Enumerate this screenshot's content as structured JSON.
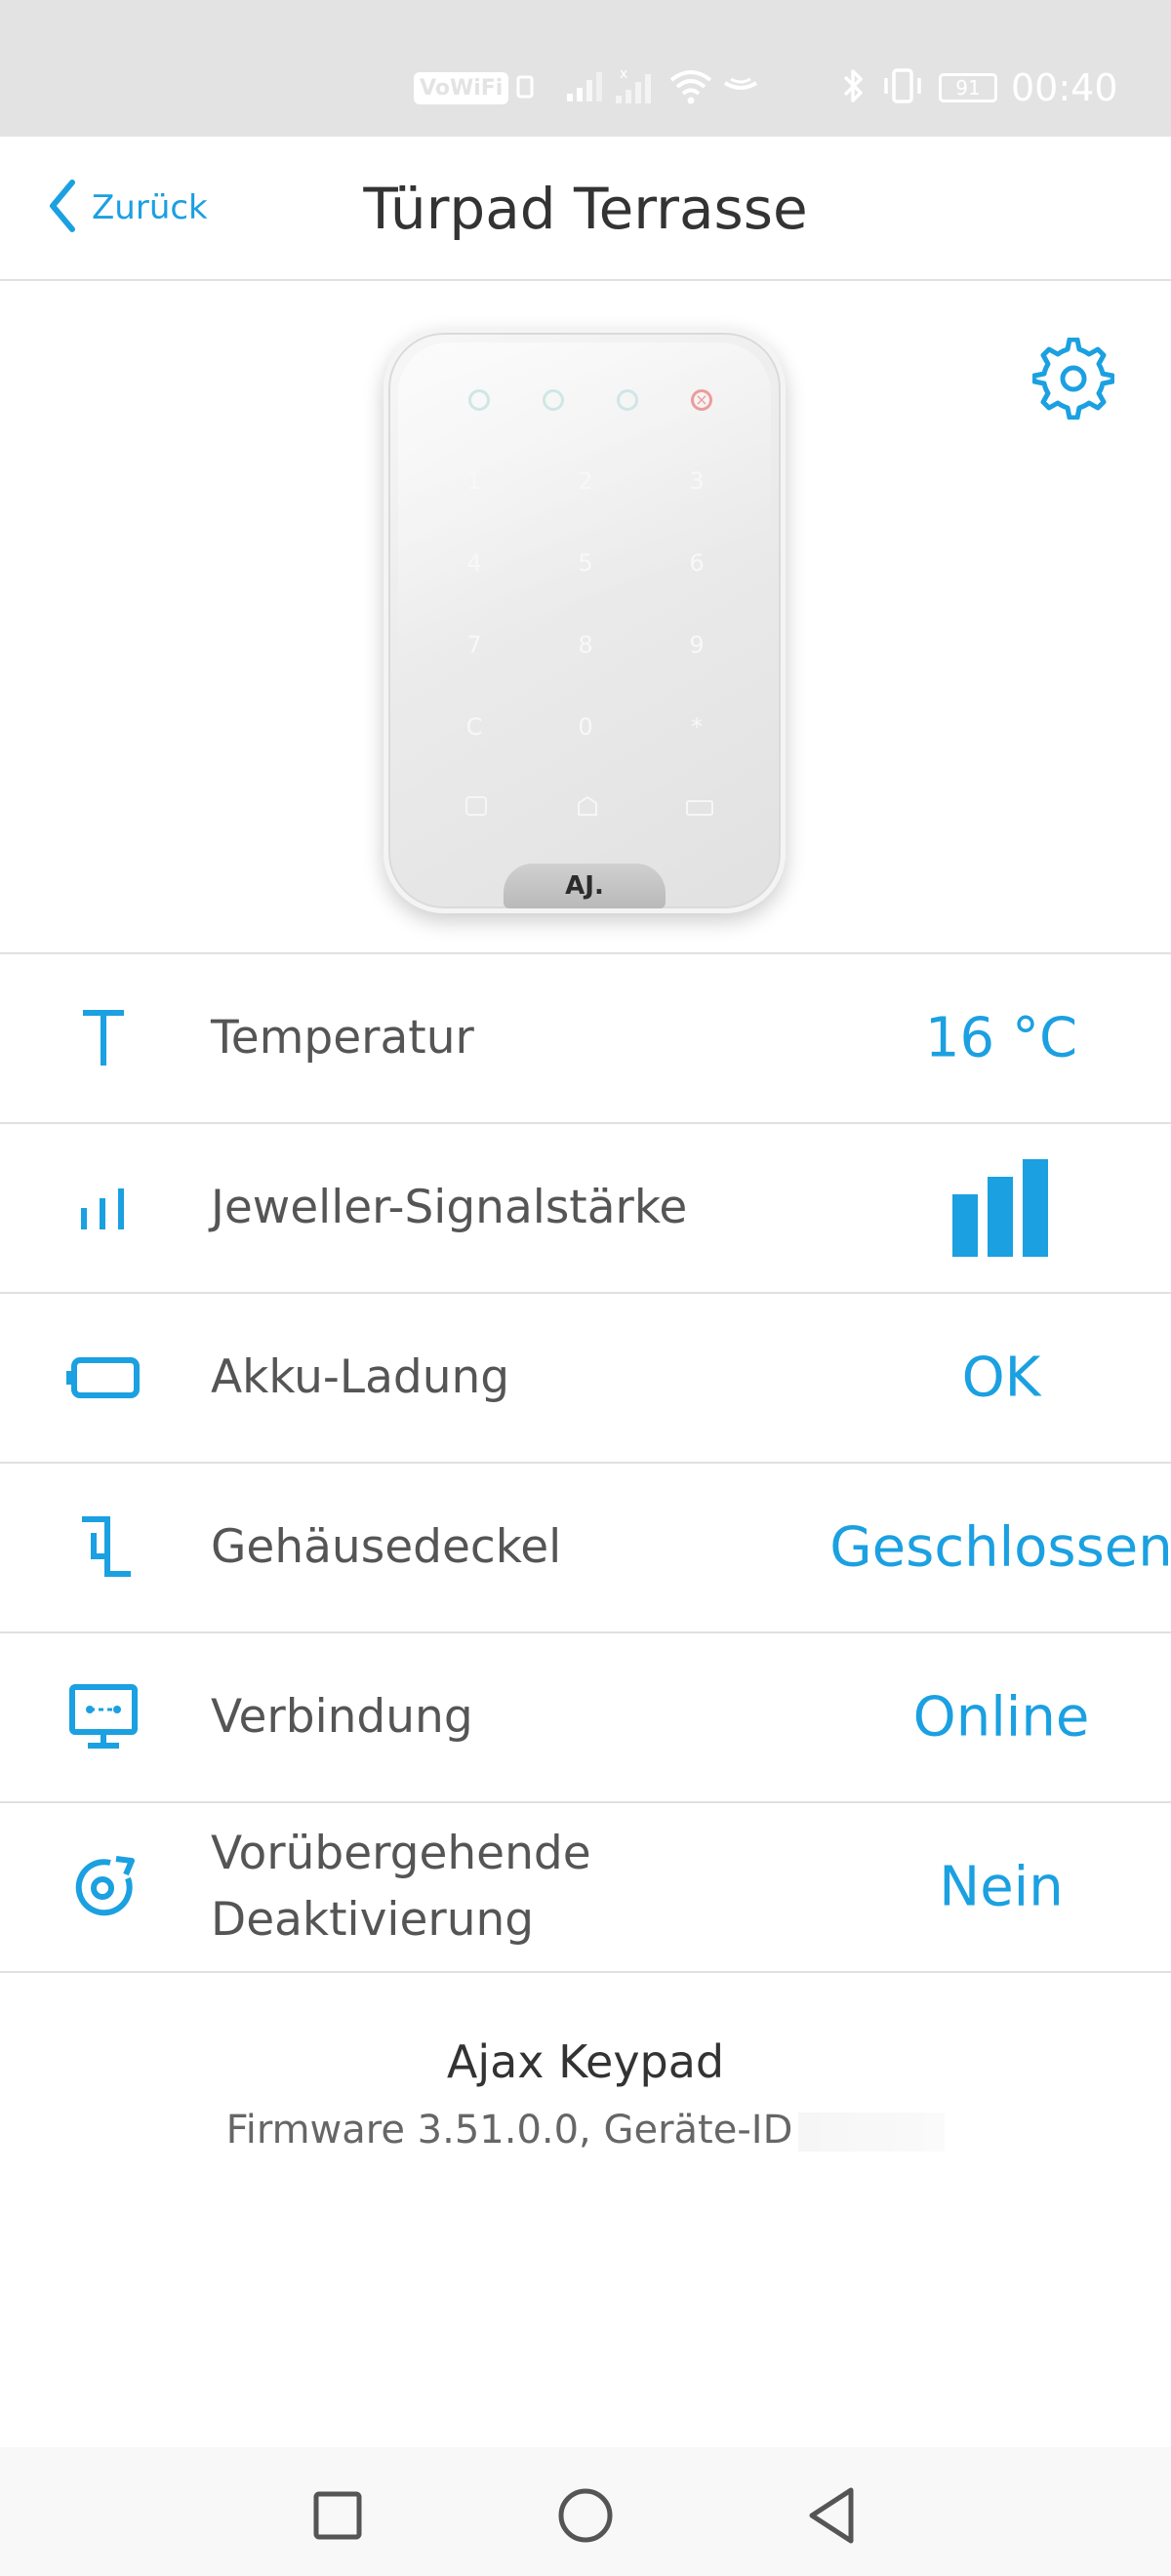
{
  "status_bar": {
    "volte": "VoWiFi",
    "battery": "91",
    "time": "00:40"
  },
  "header": {
    "back_label": "Zurück",
    "title": "Türpad Terrasse"
  },
  "device_image": {
    "keys": [
      "1",
      "2",
      "3",
      "4",
      "5",
      "6",
      "7",
      "8",
      "9",
      "C",
      "0",
      "*"
    ],
    "logo": "AJ."
  },
  "rows": [
    {
      "label": "Temperatur",
      "value": "16 °C",
      "icon": "temperature-icon"
    },
    {
      "label": "Jeweller-Signalstärke",
      "value_signal_bars": 3,
      "icon": "signal-icon"
    },
    {
      "label": "Akku-Ladung",
      "value": "OK",
      "icon": "battery-icon"
    },
    {
      "label": "Gehäusedeckel",
      "value": "Geschlossen",
      "icon": "lid-icon"
    },
    {
      "label": "Verbindung",
      "value": "Online",
      "icon": "connection-icon"
    },
    {
      "label_line1": "Vorübergehende",
      "label_line2": "Deaktivierung",
      "value": "Nein",
      "icon": "deactivation-icon"
    }
  ],
  "footer": {
    "device_name": "Ajax Keypad",
    "firmware": "Firmware 3.51.0.0, Geräte-ID"
  },
  "colors": {
    "accent": "#1ba0e1",
    "status_bar_bg": "#e3e3e3"
  }
}
